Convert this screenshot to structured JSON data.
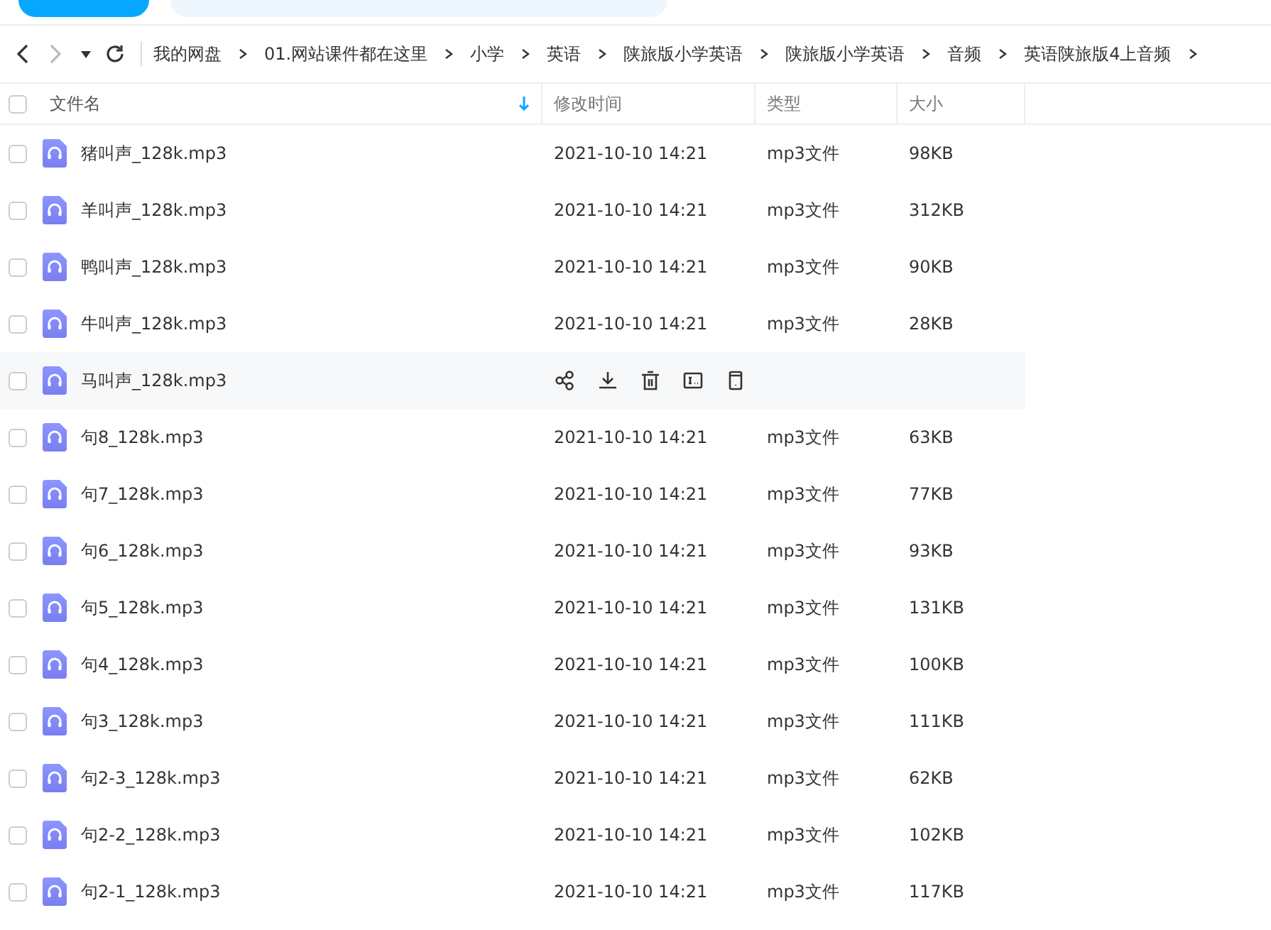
{
  "nav": {
    "back_disabled": false,
    "forward_disabled": true
  },
  "select_all_checked": false,
  "breadcrumb": [
    "我的网盘",
    "01.网站课件都在这里",
    "小学",
    "英语",
    "陕旅版小学英语",
    "陕旅版小学英语",
    "音频",
    "英语陕旅版4上音频"
  ],
  "table": {
    "columns": [
      {
        "label": "文件名",
        "sorted": true
      },
      {
        "label": "修改时间",
        "sorted": false
      },
      {
        "label": "类型",
        "sorted": false
      },
      {
        "label": "大小",
        "sorted": false
      }
    ],
    "rows": [
      {
        "name": "猪叫声_128k.mp3",
        "modified": "2021-10-10 14:21",
        "type": "mp3文件",
        "size": "98KB",
        "hovered": false,
        "checked": false
      },
      {
        "name": "羊叫声_128k.mp3",
        "modified": "2021-10-10 14:21",
        "type": "mp3文件",
        "size": "312KB",
        "hovered": false,
        "checked": false
      },
      {
        "name": "鸭叫声_128k.mp3",
        "modified": "2021-10-10 14:21",
        "type": "mp3文件",
        "size": "90KB",
        "hovered": false,
        "checked": false
      },
      {
        "name": "牛叫声_128k.mp3",
        "modified": "2021-10-10 14:21",
        "type": "mp3文件",
        "size": "28KB",
        "hovered": false,
        "checked": false
      },
      {
        "name": "马叫声_128k.mp3",
        "hovered": true,
        "checked": false
      },
      {
        "name": "句8_128k.mp3",
        "modified": "2021-10-10 14:21",
        "type": "mp3文件",
        "size": "63KB",
        "hovered": false,
        "checked": false
      },
      {
        "name": "句7_128k.mp3",
        "modified": "2021-10-10 14:21",
        "type": "mp3文件",
        "size": "77KB",
        "hovered": false,
        "checked": false
      },
      {
        "name": "句6_128k.mp3",
        "modified": "2021-10-10 14:21",
        "type": "mp3文件",
        "size": "93KB",
        "hovered": false,
        "checked": false
      },
      {
        "name": "句5_128k.mp3",
        "modified": "2021-10-10 14:21",
        "type": "mp3文件",
        "size": "131KB",
        "hovered": false,
        "checked": false
      },
      {
        "name": "句4_128k.mp3",
        "modified": "2021-10-10 14:21",
        "type": "mp3文件",
        "size": "100KB",
        "hovered": false,
        "checked": false
      },
      {
        "name": "句3_128k.mp3",
        "modified": "2021-10-10 14:21",
        "type": "mp3文件",
        "size": "111KB",
        "hovered": false,
        "checked": false
      },
      {
        "name": "句2-3_128k.mp3",
        "modified": "2021-10-10 14:21",
        "type": "mp3文件",
        "size": "62KB",
        "hovered": false,
        "checked": false
      },
      {
        "name": "句2-2_128k.mp3",
        "modified": "2021-10-10 14:21",
        "type": "mp3文件",
        "size": "102KB",
        "hovered": false,
        "checked": false
      },
      {
        "name": "句2-1_128k.mp3",
        "modified": "2021-10-10 14:21",
        "type": "mp3文件",
        "size": "117KB",
        "hovered": false,
        "checked": false
      }
    ]
  }
}
